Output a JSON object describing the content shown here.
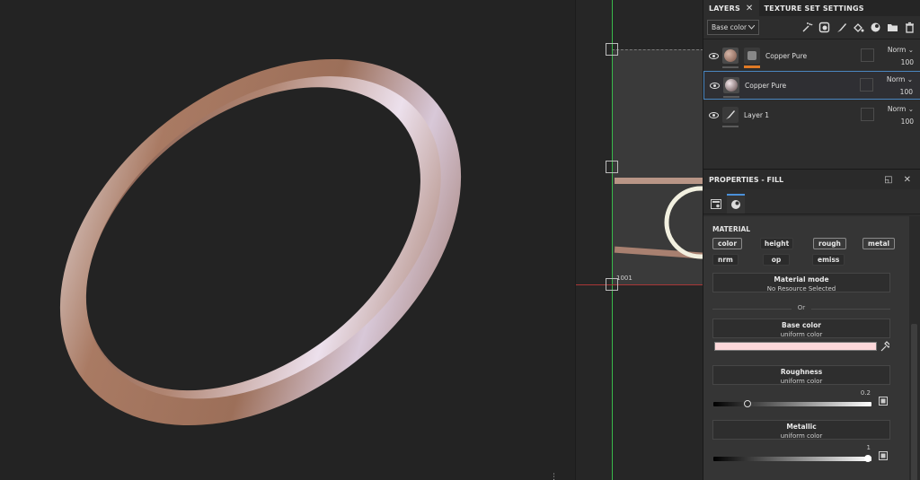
{
  "layers_panel": {
    "tabs": [
      {
        "label": "LAYERS",
        "close": "✕"
      },
      {
        "label": "TEXTURE SET SETTINGS"
      }
    ],
    "channel_select": "Base color",
    "layers": [
      {
        "name": "Copper Pure",
        "blend": "Norm",
        "opacity": "100",
        "selected": false
      },
      {
        "name": "Copper Pure",
        "blend": "Norm",
        "opacity": "100",
        "selected": true
      },
      {
        "name": "Layer 1",
        "blend": "Norm",
        "opacity": "100",
        "selected": false
      }
    ]
  },
  "properties": {
    "title": "PROPERTIES - FILL",
    "section_title": "MATERIAL",
    "channels": [
      "color",
      "height",
      "rough",
      "metal",
      "nrm",
      "op",
      "emiss"
    ],
    "material_mode": {
      "title": "Material mode",
      "subtitle": "No Resource Selected"
    },
    "or_label": "Or",
    "base_color": {
      "title": "Base color",
      "subtitle": "uniform color",
      "color": "#fcd7d9"
    },
    "roughness": {
      "title": "Roughness",
      "subtitle": "uniform color",
      "value": "0.2",
      "level": 0.2
    },
    "metallic": {
      "title": "Metallic",
      "subtitle": "uniform color",
      "value": "1",
      "level": 1.0
    }
  },
  "uv_view": {
    "udim_label": "1001"
  },
  "colors": {
    "accent": "#4a90d9",
    "mask_orange": "#e07a25",
    "axis_green": "#38b94a",
    "axis_red": "#b83a3a"
  }
}
